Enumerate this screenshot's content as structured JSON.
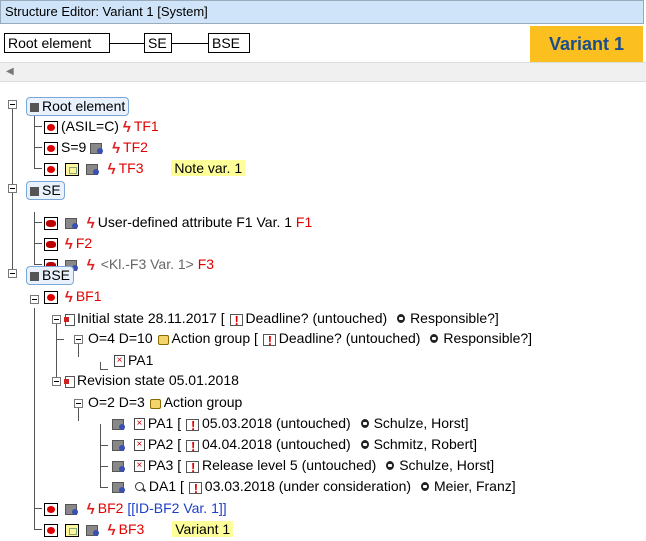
{
  "window": {
    "title": "Structure Editor: Variant 1 [System]"
  },
  "breadcrumb": {
    "root": "Root element",
    "se": "SE",
    "bse": "BSE"
  },
  "variant_badge": "Variant 1",
  "icons": {
    "scroll": "left-arrow-icon",
    "fail": "failure-icon",
    "note": "note-icon",
    "attr": "attribute-icon",
    "bolt": "lightning-icon",
    "measure": "measure-icon",
    "state": "state-icon",
    "group": "action-group-icon",
    "calendar": "calendar-icon",
    "person": "person-icon",
    "detection": "detection-action-icon"
  },
  "colors": {
    "accent": "#fbbf1f",
    "error": "#e00000",
    "link": "#1d3fc4"
  },
  "tree": {
    "root": {
      "label": "Root element",
      "r1": {
        "text": "(ASIL=C)",
        "ref": "TF1"
      },
      "r2": {
        "text": "S=9",
        "ref": "TF2"
      },
      "r3": {
        "ref": "TF3",
        "note": "Note var. 1"
      }
    },
    "se": {
      "label": "SE",
      "r1": {
        "text": "User-defined attribute F1 Var. 1",
        "ref": "F1"
      },
      "r2": {
        "ref": "F2"
      },
      "r3": {
        "text": "<Kl.-F3 Var. 1>",
        "ref": "F3"
      }
    },
    "bse": {
      "label": "BSE",
      "bf1": {
        "ref": "BF1"
      },
      "initial": {
        "text": "Initial state 28.11.2017 [",
        "deadline": "Deadline? (untouched)",
        "responsible": "Responsible?]"
      },
      "initial_group": {
        "prefix": "O=4 D=10",
        "group": "Action group [",
        "deadline": "Deadline? (untouched)",
        "responsible": "Responsible?]"
      },
      "initial_pa1": "PA1",
      "revision": {
        "text": "Revision state 05.01.2018"
      },
      "revision_group": {
        "prefix": "O=2 D=3",
        "group": "Action group"
      },
      "actions": [
        {
          "id": "PA1 [",
          "date": "05.03.2018 (untouched)",
          "person": "Schulze, Horst]"
        },
        {
          "id": "PA2 [",
          "date": "04.04.2018 (untouched)",
          "person": "Schmitz, Robert]"
        },
        {
          "id": "PA3 [",
          "date": "Release level 5 (untouched)",
          "person": "Schulze, Horst]"
        },
        {
          "id": "DA1 [",
          "date": "03.03.2018 (under consideration)",
          "person": "Meier, Franz]"
        }
      ],
      "bf2": {
        "ref": "BF2",
        "link": "[[ID-BF2 Var. 1]]"
      },
      "bf3": {
        "ref": "BF3",
        "note": "Variant 1"
      }
    }
  }
}
